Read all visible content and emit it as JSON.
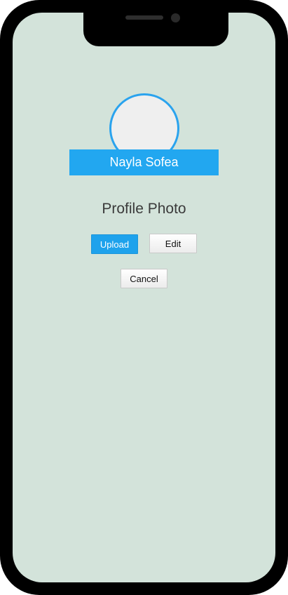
{
  "profile": {
    "name": "Nayla Sofea",
    "title": "Profile Photo"
  },
  "actions": {
    "upload_label": "Upload",
    "edit_label": "Edit",
    "cancel_label": "Cancel"
  },
  "colors": {
    "screen_background": "#d3e3da",
    "accent": "#22a7f0",
    "avatar_placeholder": "#efefef"
  }
}
